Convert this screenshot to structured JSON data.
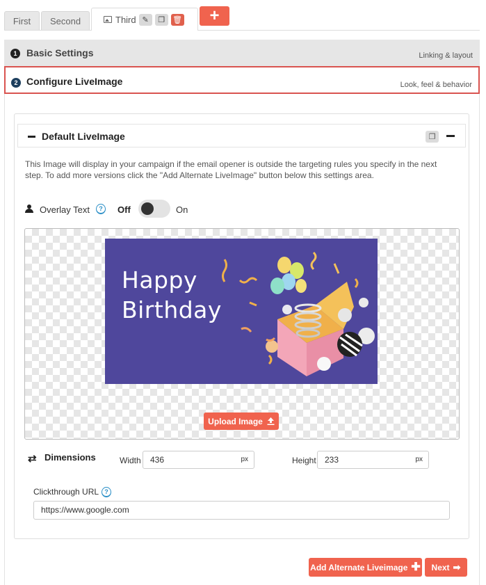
{
  "tabs": [
    {
      "label": "First"
    },
    {
      "label": "Second"
    },
    {
      "label": "Third"
    }
  ],
  "tab_actions": {
    "edit_icon": "pencil-icon",
    "copy_icon": "copy-icon",
    "delete_icon": "trash-icon"
  },
  "add_tab_symbol": "+",
  "steps": [
    {
      "number": "1",
      "title": "Basic Settings",
      "subtitle": "Linking & layout"
    },
    {
      "number": "2",
      "title": "Configure LiveImage",
      "subtitle": "Look, feel & behavior"
    }
  ],
  "panel": {
    "title": "Default LiveImage",
    "description": "This Image will display in your campaign if the email opener is outside the targeting rules you specify in the next step. To add more versions click the \"Add Alternate LiveImage\" button below this settings area."
  },
  "overlay": {
    "label": "Overlay Text",
    "help": "?",
    "off_label": "Off",
    "on_label": "On",
    "enabled": false
  },
  "image": {
    "line1": "Happy",
    "line2": "Birthday",
    "background": "#4f479c"
  },
  "upload_button": "Upload Image",
  "dimensions": {
    "label": "Dimensions",
    "width_label": "Width",
    "width_value": "436",
    "width_unit": "px",
    "height_label": "Height",
    "height_value": "233",
    "height_unit": "px"
  },
  "clickthrough": {
    "label": "Clickthrough URL",
    "help": "?",
    "value": "https://www.google.com"
  },
  "buttons": {
    "add_alternate": "Add Alternate Liveimage",
    "next": "Next"
  },
  "colors": {
    "accent": "#f0634e",
    "highlight_border": "#d9534f",
    "step2_badge": "#1d3f5e"
  }
}
